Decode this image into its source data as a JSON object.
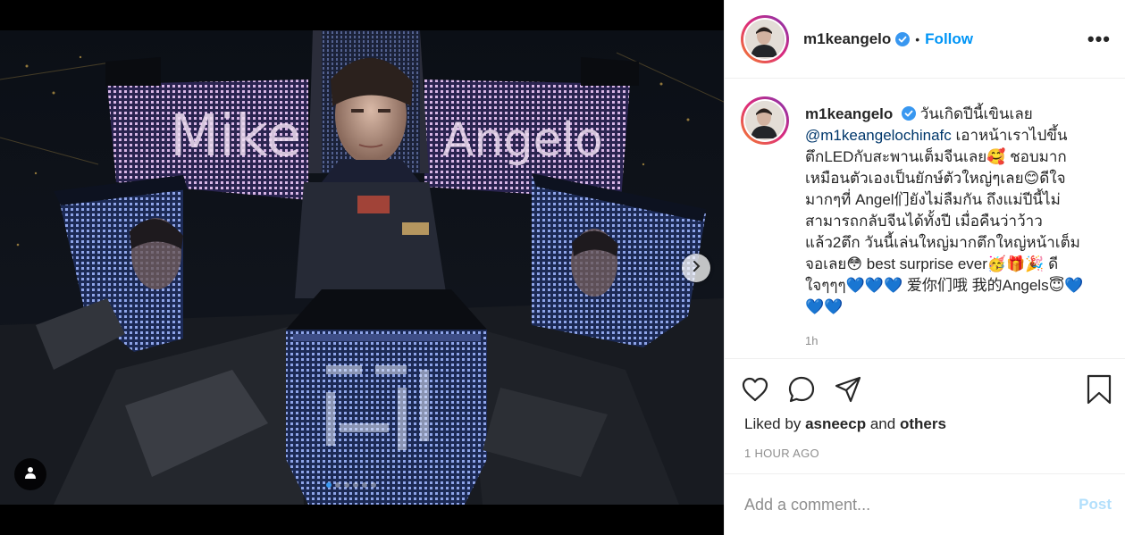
{
  "post": {
    "username": "m1keangelo",
    "follow_label": "Follow",
    "more_label": "•••",
    "separator": "•",
    "caption": {
      "username": "m1keangelo",
      "text_1": "วันเกิดปีนี้เขินเลย",
      "mention": "@m1keangelochinafc",
      "text_2": "เอาหน้าเราไปขึ้นตึกLEDกับสะพานเต็มจีนเลย🥰 ชอบมากเหมือนตัวเองเป็นยักษ์ตัวใหญ่ๆเลย😊ดีใจมากๆที่ Angel们ยังไม่ลืมกัน ถึงแม่ปีนี้ไม่สามารถกลับจีนได้ทั้งปี เมื่อคืนว่าว้าวแล้ว2ตึก วันนี้เล่นใหญ่มากตึกใหญ่หน้าเต็มจอเลย😳 best surprise ever🥳🎁🎉 ดีใจๆๆๆ💙💙💙 爱你们哦 我的Angels😇💙💙💙",
      "time": "1h"
    },
    "likes": {
      "prefix": "Liked by",
      "user": "asneecp",
      "conjunction": "and",
      "others": "others"
    },
    "time_ago": "1 HOUR AGO",
    "comment_placeholder": "Add a comment...",
    "post_label": "Post",
    "carousel": {
      "slides": 6,
      "active": 1
    },
    "photo_text": {
      "left_sign": "Mike",
      "right_sign": "Angelo"
    }
  },
  "icons": {
    "verified": "verified-badge-icon",
    "like": "heart-icon",
    "comment": "comment-icon",
    "share": "paper-plane-icon",
    "save": "bookmark-icon",
    "next": "chevron-right-icon",
    "tag": "user-tag-icon"
  },
  "colors": {
    "accent": "#0095f6",
    "verified": "#3897f0",
    "muted": "#8e8e8e",
    "post_disabled": "#b2dffc"
  }
}
